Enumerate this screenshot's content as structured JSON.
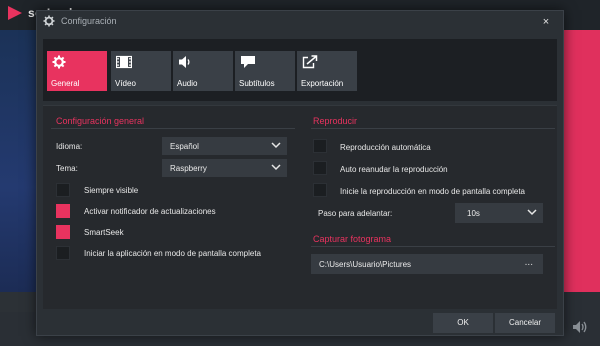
{
  "background_app": {
    "logo_text": "so Leah"
  },
  "dialog": {
    "title": "Configuración",
    "close_label": "×"
  },
  "tabs": [
    {
      "label": "General",
      "icon": "gear-icon",
      "active": true
    },
    {
      "label": "Vídeo",
      "icon": "film-icon",
      "active": false
    },
    {
      "label": "Audio",
      "icon": "speaker-icon",
      "active": false
    },
    {
      "label": "Subtítulos",
      "icon": "speech-bubble-icon",
      "active": false
    },
    {
      "label": "Exportación",
      "icon": "export-icon",
      "active": false
    }
  ],
  "general": {
    "heading": "Configuración general",
    "language_label": "Idioma:",
    "language_value": "Español",
    "theme_label": "Tema:",
    "theme_value": "Raspberry",
    "options": [
      {
        "label": "Siempre visible",
        "checked": false
      },
      {
        "label": "Activar notificador de actualizaciones",
        "checked": true
      },
      {
        "label": "SmartSeek",
        "checked": true
      },
      {
        "label": "Iniciar la aplicación en modo de pantalla completa",
        "checked": false
      }
    ]
  },
  "playback": {
    "heading": "Reproducir",
    "options": [
      {
        "label": "Reproducción automática",
        "checked": false
      },
      {
        "label": "Auto reanudar la reproducción",
        "checked": false
      },
      {
        "label": "Inicie la reproducción en modo de pantalla completa",
        "checked": false
      }
    ],
    "step_label": "Paso para adelantar:",
    "step_value": "10s"
  },
  "screenshot": {
    "heading": "Capturar fotograma",
    "path": "C:\\Users\\Usuario\\Pictures",
    "browse_label": "..."
  },
  "footer": {
    "ok_label": "OK",
    "cancel_label": "Cancelar"
  },
  "colors": {
    "accent": "#e8335f",
    "dialog_bg": "#2b3035",
    "tab_inactive": "#3a4047"
  }
}
